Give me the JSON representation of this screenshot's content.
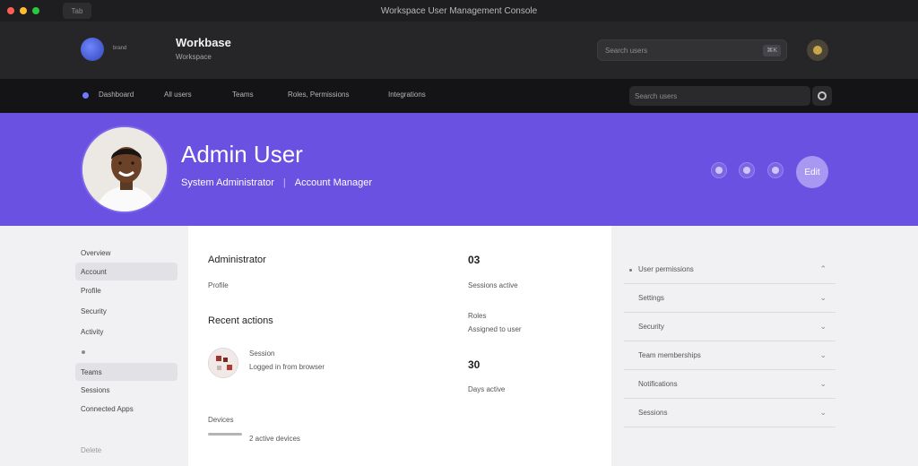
{
  "window": {
    "title": "Workspace User Management Console",
    "tab_button": "Tab",
    "traffic_lights": {
      "close": "#ff5f57",
      "minimize": "#febc2e",
      "maximize": "#28c840"
    }
  },
  "header": {
    "brand_small": "brand",
    "app_name": "Workbase",
    "app_subtitle": "Workspace",
    "search_placeholder": "Search users",
    "search_shortcut": "⌘K",
    "avatar_icon": "user-avatar"
  },
  "nav": {
    "items": [
      "Dashboard",
      "All users",
      "Teams",
      "Roles, Permissions",
      "Integrations"
    ],
    "search_placeholder": "Search users",
    "action_icon": "refresh-icon"
  },
  "profile": {
    "name": "Admin User",
    "role": "System Administrator",
    "secondary_role": "Account Manager",
    "accent_color": "#6b51e2",
    "action_label": "Edit"
  },
  "sidebar": {
    "items": [
      "Overview",
      "Account",
      "Profile",
      "Security",
      "Activity",
      "Teams",
      "Sessions",
      "Connected Apps",
      "Delete"
    ],
    "active_index": 1,
    "highlight_index": 5
  },
  "main": {
    "section_title": "Administrator",
    "section_sub": "Profile",
    "recent_title": "Recent actions",
    "recent_item_title": "Session",
    "recent_item_sub": "Logged in from browser",
    "bottom_title": "Devices",
    "bottom_sub": "2 active devices",
    "stats": [
      {
        "value": "03",
        "label": "Sessions active"
      },
      {
        "value": "",
        "label": "Roles",
        "sub": "Assigned to user"
      },
      {
        "value": "30",
        "label": "Days active"
      }
    ]
  },
  "right": {
    "rows": [
      "User permissions",
      "Settings",
      "Security",
      "Team memberships",
      "Notifications",
      "Sessions"
    ],
    "open_index": 0
  }
}
